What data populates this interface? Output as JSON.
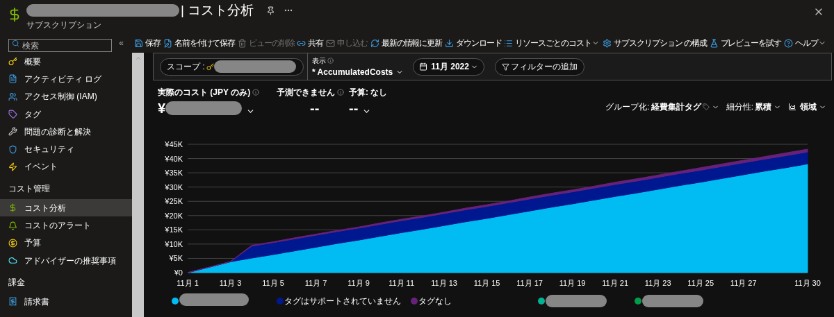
{
  "header": {
    "title": "| コスト分析",
    "subtitle": "サブスクリプション"
  },
  "sidebar": {
    "search": {
      "placeholder": "検索"
    },
    "collapse": "«",
    "sections": [
      {
        "items": [
          {
            "label": "概要",
            "selected": false
          },
          {
            "label": "アクティビティ ログ",
            "selected": false
          },
          {
            "label": "アクセス制御 (IAM)",
            "selected": false
          },
          {
            "label": "タグ",
            "selected": false
          },
          {
            "label": "問題の診断と解決",
            "selected": false
          },
          {
            "label": "セキュリティ",
            "selected": false
          },
          {
            "label": "イベント",
            "selected": false
          }
        ]
      },
      {
        "title": "コスト管理",
        "items": [
          {
            "label": "コスト分析",
            "selected": true
          },
          {
            "label": "コストのアラート",
            "selected": false
          },
          {
            "label": "予算",
            "selected": false
          },
          {
            "label": "アドバイザーの推奨事項",
            "selected": false
          }
        ]
      },
      {
        "title": "課金",
        "items": [
          {
            "label": "請求書",
            "selected": false
          }
        ]
      }
    ]
  },
  "toolbar": [
    {
      "label": "保存",
      "disabled": false,
      "dropdown": false
    },
    {
      "label": "名前を付けて保存",
      "disabled": false,
      "dropdown": false
    },
    {
      "label": "ビューの削除",
      "disabled": true,
      "dropdown": false
    },
    {
      "label": "共有",
      "disabled": false,
      "dropdown": false
    },
    {
      "label": "申し込む",
      "disabled": true,
      "dropdown": false
    },
    {
      "label": "最新の情報に更新",
      "disabled": false,
      "dropdown": false
    },
    {
      "label": "ダウンロード",
      "disabled": false,
      "dropdown": false
    },
    {
      "label": "リソースごとのコスト",
      "disabled": false,
      "dropdown": true
    },
    {
      "label": "サブスクリプション の構成",
      "disabled": false,
      "dropdown": false
    },
    {
      "label": "プレビューを試す",
      "disabled": false,
      "dropdown": false
    },
    {
      "label": "ヘルプ",
      "disabled": false,
      "dropdown": true
    }
  ],
  "filters": {
    "scope_label": "スコープ :",
    "view_label": "表示",
    "view": "* AccumulatedCosts",
    "date": "11月 2022",
    "add_filter": "フィルターの追加"
  },
  "metrics": [
    {
      "label": "実際のコスト (JPY のみ)",
      "value": "¥",
      "info": true,
      "dropdown": true,
      "redacted": true
    },
    {
      "label": "予測できません",
      "value": "--",
      "info": true,
      "dropdown": false,
      "redacted": false
    },
    {
      "label": "予算: なし",
      "value": "--",
      "info": false,
      "dropdown": true,
      "redacted": false
    }
  ],
  "chart_options": [
    {
      "kind": "tag",
      "label": "グループ化:",
      "value": "経費集計タグ"
    },
    {
      "kind": "plain",
      "label": "細分性:",
      "value": "累積"
    },
    {
      "kind": "area",
      "value": "領域"
    }
  ],
  "extra_legend": [
    {
      "color": "#00b294"
    },
    {
      "color": "#009e49"
    }
  ],
  "chart_data": {
    "type": "area",
    "stacked": true,
    "grid": true,
    "legend": "bottom",
    "categories": [
      "11月 1",
      null,
      "11月 3",
      null,
      "11月 5",
      null,
      "11月 7",
      null,
      "11月 9",
      null,
      "11月 11",
      null,
      "11月 13",
      null,
      "11月 15",
      null,
      "11月 17",
      null,
      "11月 19",
      null,
      "11月 21",
      null,
      "11月 23",
      null,
      "11月 25",
      null,
      "11月 27",
      null,
      null,
      "11月 30"
    ],
    "ylim": [
      0,
      45000
    ],
    "yticks": [
      {
        "value": 0,
        "label": "¥0"
      },
      {
        "value": 5000,
        "label": "¥5K"
      },
      {
        "value": 10000,
        "label": "¥10K"
      },
      {
        "value": 15000,
        "label": "¥15K"
      },
      {
        "value": 20000,
        "label": "¥20K"
      },
      {
        "value": 25000,
        "label": "¥25K"
      },
      {
        "value": 30000,
        "label": "¥30K"
      },
      {
        "value": 35000,
        "label": "¥35K"
      },
      {
        "value": 40000,
        "label": "¥40K"
      },
      {
        "value": 45000,
        "label": "¥45K"
      }
    ],
    "series": [
      {
        "color": "#00bcf2",
        "values": [
          0,
          1900,
          3800,
          5100,
          6300,
          7600,
          8900,
          10200,
          11400,
          12700,
          14000,
          15200,
          16500,
          17800,
          19000,
          20300,
          21600,
          22900,
          24100,
          25400,
          26700,
          27900,
          29200,
          30500,
          31700,
          33000,
          34300,
          35600,
          36800,
          38100
        ]
      },
      {
        "name": "タグはサポートされていません",
        "color": "#00188f",
        "values": [
          0,
          0,
          0,
          4200,
          4200,
          4200,
          4200,
          4200,
          4200,
          4200,
          4200,
          4200,
          4200,
          4200,
          4200,
          4200,
          4200,
          4200,
          4200,
          4200,
          4200,
          4200,
          4200,
          4200,
          4200,
          4200,
          4200,
          4200,
          4200,
          4200
        ]
      },
      {
        "name": "タグなし",
        "color": "#68217a",
        "values": [
          0,
          0,
          100,
          300,
          300,
          400,
          400,
          400,
          400,
          500,
          500,
          500,
          500,
          600,
          600,
          600,
          700,
          700,
          700,
          700,
          800,
          800,
          800,
          800,
          900,
          900,
          900,
          900,
          1000,
          1000
        ]
      }
    ]
  }
}
